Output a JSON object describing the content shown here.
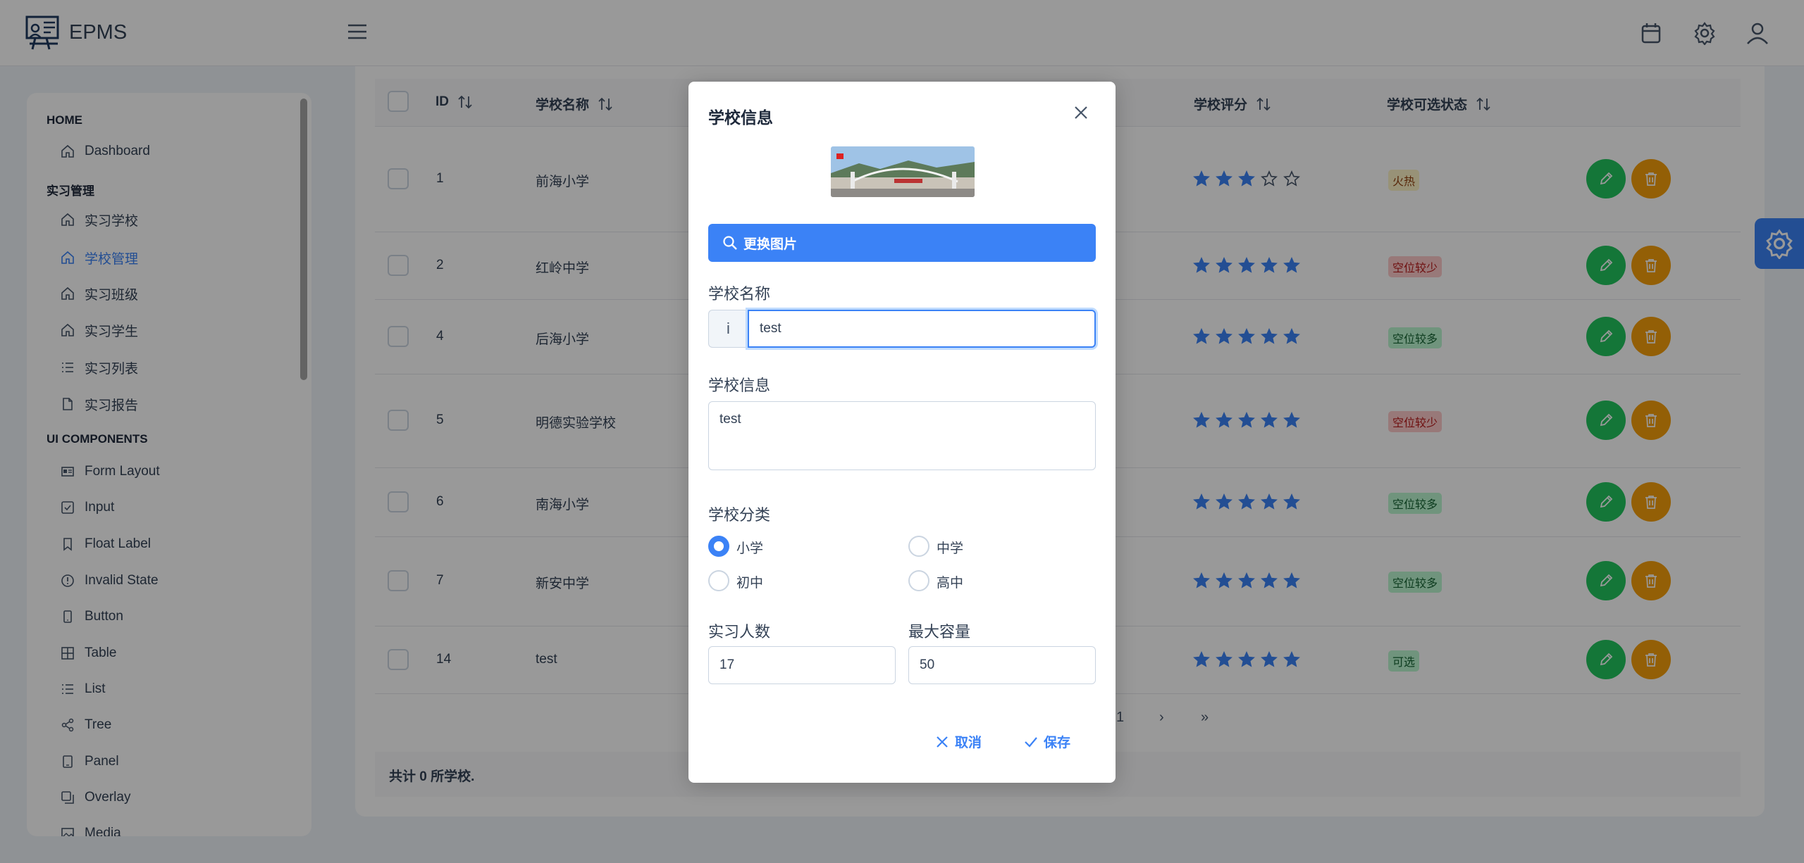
{
  "app": {
    "title": "EPMS"
  },
  "sidebar": {
    "sections": [
      {
        "label": "HOME"
      },
      {
        "label": "实习管理"
      },
      {
        "label": "UI COMPONENTS"
      }
    ],
    "items": [
      {
        "label": "Dashboard",
        "icon": "home-icon"
      },
      {
        "label": "实习学校",
        "icon": "home-icon"
      },
      {
        "label": "学校管理",
        "icon": "home-icon",
        "active": true
      },
      {
        "label": "实习班级",
        "icon": "home-icon"
      },
      {
        "label": "实习学生",
        "icon": "home-icon"
      },
      {
        "label": "实习列表",
        "icon": "list-icon"
      },
      {
        "label": "实习报告",
        "icon": "file-icon"
      },
      {
        "label": "Form Layout",
        "icon": "id-card-icon"
      },
      {
        "label": "Input",
        "icon": "check-square-icon"
      },
      {
        "label": "Float Label",
        "icon": "bookmark-icon"
      },
      {
        "label": "Invalid State",
        "icon": "exclamation-circle-icon"
      },
      {
        "label": "Button",
        "icon": "mobile-icon"
      },
      {
        "label": "Table",
        "icon": "table-icon"
      },
      {
        "label": "List",
        "icon": "list-icon"
      },
      {
        "label": "Tree",
        "icon": "share-icon"
      },
      {
        "label": "Panel",
        "icon": "tablet-icon"
      },
      {
        "label": "Overlay",
        "icon": "clone-icon"
      },
      {
        "label": "Media",
        "icon": "image-icon"
      }
    ]
  },
  "table": {
    "headers": {
      "id": "ID",
      "name": "学校名称",
      "rating": "学校评分",
      "status": "学校可选状态"
    },
    "rows": [
      {
        "id": "1",
        "name": "前海小学",
        "rating": 3,
        "status": "火热",
        "status_color": "#fef3c7"
      },
      {
        "id": "2",
        "name": "红岭中学",
        "rating": 5,
        "status": "空位较少",
        "status_color": "#fecaca"
      },
      {
        "id": "4",
        "name": "后海小学",
        "rating": 5,
        "status": "空位较多",
        "status_color": "#bbf7d0"
      },
      {
        "id": "5",
        "name": "明德实验学校",
        "rating": 5,
        "status": "空位较少",
        "status_color": "#fecaca"
      },
      {
        "id": "6",
        "name": "南海小学",
        "rating": 5,
        "status": "空位较多",
        "status_color": "#bbf7d0"
      },
      {
        "id": "7",
        "name": "新安中学",
        "rating": 5,
        "status": "空位较多",
        "status_color": "#bbf7d0"
      },
      {
        "id": "14",
        "name": "test",
        "rating": 5,
        "status": "可选",
        "status_color": "#bbf7d0"
      }
    ],
    "pagination": {
      "current": "1",
      "next": "›",
      "last": "»"
    },
    "footer": "共计 0 所学校."
  },
  "dialog": {
    "title": "学校信息",
    "change_image": "更换图片",
    "name_label": "学校名称",
    "name_addon": "i",
    "name_value": "test",
    "info_label": "学校信息",
    "info_value": "test",
    "category_label": "学校分类",
    "categories": [
      {
        "label": "小学",
        "checked": true
      },
      {
        "label": "中学",
        "checked": false
      },
      {
        "label": "初中",
        "checked": false
      },
      {
        "label": "高中",
        "checked": false
      }
    ],
    "count_label": "实习人数",
    "count_value": "17",
    "capacity_label": "最大容量",
    "capacity_value": "50",
    "cancel": "取消",
    "save": "保存"
  },
  "colors": {
    "primary": "#3b82f6",
    "edit": "#22c55e",
    "delete": "#f59e0b"
  }
}
